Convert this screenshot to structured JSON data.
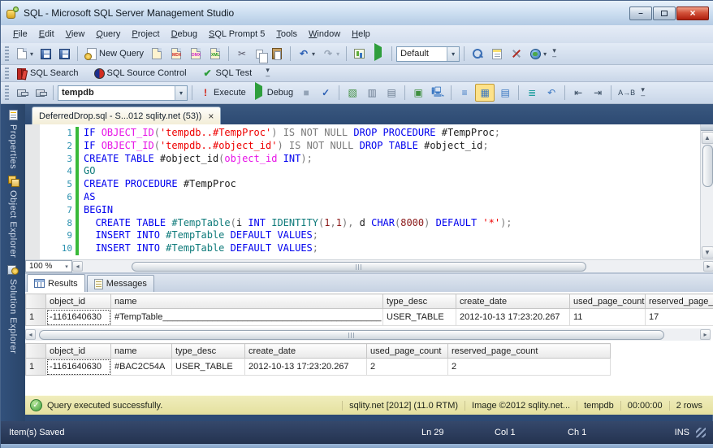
{
  "window": {
    "title": "SQL - Microsoft SQL Server Management Studio",
    "minimize": "–",
    "close": "×"
  },
  "menu": {
    "items": [
      "File",
      "Edit",
      "View",
      "Query",
      "Project",
      "Debug",
      "SQL Prompt 5",
      "Tools",
      "Window",
      "Help"
    ]
  },
  "toolbar1": {
    "new_query_label": "New Query",
    "default_combo_value": "Default"
  },
  "toolbar2": {
    "items": [
      "SQL Search",
      "SQL Source Control",
      "SQL Test"
    ]
  },
  "toolbar3": {
    "database_combo_value": "tempdb",
    "execute_label": "Execute",
    "debug_label": "Debug",
    "rename_label": "A→B"
  },
  "icons": {
    "dropdown_caret": "▾",
    "cut": "✂",
    "undo": "↶",
    "redo": "↷",
    "stop": "■",
    "parse_check": "✓",
    "test_check": "✔",
    "execute_excl": "!",
    "overflow": "▾",
    "scroll_up": "▲",
    "scroll_down": "▼",
    "scroll_left": "◂",
    "scroll_right": "▸",
    "results_text": "≡",
    "results_grid": "▦",
    "results_file": "▤",
    "comment": "≣",
    "uncomment": "≡",
    "outdent": "⇤",
    "indent": "⇥",
    "disconnect_x": "×",
    "status_check": "✓"
  },
  "sidebar": {
    "tabs": [
      {
        "label": "Properties"
      },
      {
        "label": "Object Explorer"
      },
      {
        "label": "Solution Explorer"
      }
    ]
  },
  "editor_tab": {
    "title": "DeferredDrop.sql - S...012 sqlity.net (53))",
    "close": "×"
  },
  "editor": {
    "zoom_value": "100 %",
    "lines": [
      {
        "n": "1",
        "t": [
          {
            "s": "IF ",
            "c": "kw"
          },
          {
            "s": "OBJECT_ID",
            "c": "fn"
          },
          {
            "s": "(",
            "c": "gr"
          },
          {
            "s": "'tempdb..#TempProc'",
            "c": "str"
          },
          {
            "s": ") ",
            "c": "gr"
          },
          {
            "s": "IS NOT NULL ",
            "c": "gr"
          },
          {
            "s": "DROP PROCEDURE ",
            "c": "kw"
          },
          {
            "s": "#TempProc",
            "c": "id"
          },
          {
            "s": ";",
            "c": "gr"
          }
        ]
      },
      {
        "n": "2",
        "t": [
          {
            "s": "IF ",
            "c": "kw"
          },
          {
            "s": "OBJECT_ID",
            "c": "fn"
          },
          {
            "s": "(",
            "c": "gr"
          },
          {
            "s": "'tempdb..#object_id'",
            "c": "str"
          },
          {
            "s": ") ",
            "c": "gr"
          },
          {
            "s": "IS NOT NULL ",
            "c": "gr"
          },
          {
            "s": "DROP TABLE ",
            "c": "kw"
          },
          {
            "s": "#object_id",
            "c": "id"
          },
          {
            "s": ";",
            "c": "gr"
          }
        ]
      },
      {
        "n": "3",
        "t": [
          {
            "s": "CREATE TABLE ",
            "c": "kw"
          },
          {
            "s": "#object_id",
            "c": "id"
          },
          {
            "s": "(",
            "c": "gr"
          },
          {
            "s": "object_id",
            "c": "fn"
          },
          {
            "s": " INT",
            "c": "kw"
          },
          {
            "s": ");",
            "c": "gr"
          }
        ]
      },
      {
        "n": "4",
        "t": [
          {
            "s": "GO",
            "c": "go"
          }
        ]
      },
      {
        "n": "5",
        "t": [
          {
            "s": "CREATE PROCEDURE ",
            "c": "kw"
          },
          {
            "s": "#TempProc",
            "c": "id"
          }
        ]
      },
      {
        "n": "6",
        "t": [
          {
            "s": "AS",
            "c": "kw"
          }
        ]
      },
      {
        "n": "7",
        "t": [
          {
            "s": "BEGIN",
            "c": "kw"
          }
        ]
      },
      {
        "n": "8",
        "t": [
          {
            "s": "  ",
            "c": "id"
          },
          {
            "s": "CREATE TABLE ",
            "c": "kw"
          },
          {
            "s": "#TempTable",
            "c": "tbl"
          },
          {
            "s": "(",
            "c": "gr"
          },
          {
            "s": "i ",
            "c": "id"
          },
          {
            "s": "INT ",
            "c": "kw"
          },
          {
            "s": "IDENTITY",
            "c": "tbl"
          },
          {
            "s": "(",
            "c": "gr"
          },
          {
            "s": "1",
            "c": "num"
          },
          {
            "s": ",",
            "c": "gr"
          },
          {
            "s": "1",
            "c": "num"
          },
          {
            "s": ")",
            "c": "gr"
          },
          {
            "s": ", ",
            "c": "gr"
          },
          {
            "s": "d ",
            "c": "id"
          },
          {
            "s": "CHAR",
            "c": "kw"
          },
          {
            "s": "(",
            "c": "gr"
          },
          {
            "s": "8000",
            "c": "num"
          },
          {
            "s": ") ",
            "c": "gr"
          },
          {
            "s": "DEFAULT ",
            "c": "kw"
          },
          {
            "s": "'*'",
            "c": "str"
          },
          {
            "s": ");",
            "c": "gr"
          }
        ]
      },
      {
        "n": "9",
        "t": [
          {
            "s": "  ",
            "c": "id"
          },
          {
            "s": "INSERT INTO ",
            "c": "kw"
          },
          {
            "s": "#TempTable ",
            "c": "tbl"
          },
          {
            "s": "DEFAULT VALUES",
            "c": "kw"
          },
          {
            "s": ";",
            "c": "gr"
          }
        ]
      },
      {
        "n": "10",
        "t": [
          {
            "s": "  ",
            "c": "id"
          },
          {
            "s": "INSERT INTO ",
            "c": "kw"
          },
          {
            "s": "#TempTable ",
            "c": "tbl"
          },
          {
            "s": "DEFAULT VALUES",
            "c": "kw"
          },
          {
            "s": ";",
            "c": "gr"
          }
        ]
      }
    ]
  },
  "results": {
    "tabs": [
      {
        "label": "Results"
      },
      {
        "label": "Messages"
      }
    ],
    "grid1": {
      "columns": [
        "object_id",
        "name",
        "type_desc",
        "create_date",
        "used_page_count",
        "reserved_page_count"
      ],
      "rows": [
        [
          "1",
          "-1161640630",
          "#TempTable____________________________________________ ...",
          "USER_TABLE",
          "2012-10-13 17:23:20.267",
          "11",
          "17"
        ]
      ]
    },
    "grid2": {
      "columns": [
        "object_id",
        "name",
        "type_desc",
        "create_date",
        "used_page_count",
        "reserved_page_count"
      ],
      "rows": [
        [
          "1",
          "-1161640630",
          "#BAC2C54A",
          "USER_TABLE",
          "2012-10-13 17:23:20.267",
          "2",
          "2"
        ]
      ]
    }
  },
  "query_status": {
    "message": "Query executed successfully.",
    "segments": [
      "sqlity.net [2012] (11.0 RTM)",
      "Image ©2012 sqlity.net...",
      "tempdb",
      "00:00:00",
      "2 rows"
    ]
  },
  "status_bar": {
    "left": "Item(s) Saved",
    "items": [
      "Ln 29",
      "Col 1",
      "Ch 1",
      "INS"
    ]
  },
  "colors": {
    "keyword": "#0000ee",
    "function": "#e713e7",
    "string": "#ee0000",
    "comment_gray": "#7b7b7b",
    "line_number": "#2b91af",
    "status_bg": "#2b3a57",
    "query_status_bg": "#ece9a9",
    "dock_bg": "#2d4a73"
  }
}
